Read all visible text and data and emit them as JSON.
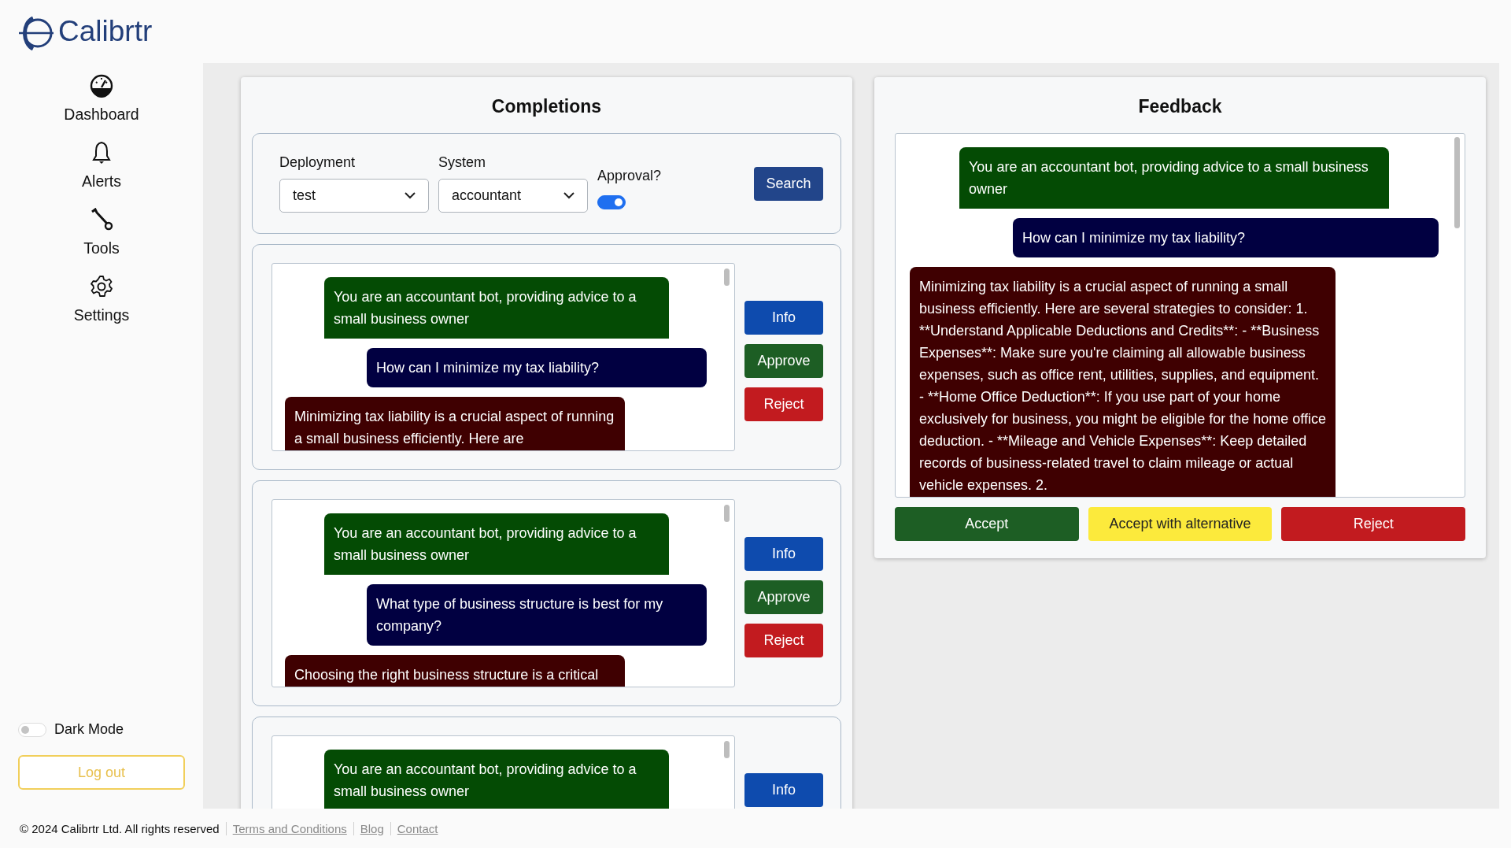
{
  "brand": {
    "name": "Calibrtr"
  },
  "sidebar": {
    "items": [
      {
        "label": "Dashboard",
        "kind": "dashboard"
      },
      {
        "label": "Alerts",
        "kind": "alerts"
      },
      {
        "label": "Tools",
        "kind": "tools"
      },
      {
        "label": "Settings",
        "kind": "settings"
      }
    ],
    "dark_mode": {
      "label": "Dark Mode",
      "on": false
    },
    "logout": "Log out"
  },
  "completions": {
    "title": "Completions",
    "filters": {
      "deployment": {
        "label": "Deployment",
        "value": "test"
      },
      "system": {
        "label": "System",
        "value": "accountant"
      },
      "approval": {
        "label": "Approval?",
        "on": true
      },
      "search": "Search"
    },
    "conversations": [
      {
        "messages": [
          {
            "kind": "system",
            "text": "You are an accountant bot, providing advice to a small business owner"
          },
          {
            "kind": "user",
            "text": "How can I minimize my tax liability?"
          },
          {
            "kind": "assistant",
            "text": "Minimizing tax liability is a crucial aspect of running a small business efficiently. Here are"
          }
        ],
        "buttons": [
          {
            "label": "Info",
            "kind": "info"
          },
          {
            "label": "Approve",
            "kind": "approve"
          },
          {
            "label": "Reject",
            "kind": "reject"
          }
        ]
      },
      {
        "messages": [
          {
            "kind": "system",
            "text": "You are an accountant bot, providing advice to a small business owner"
          },
          {
            "kind": "user",
            "text": "What type of business structure is best for my company?"
          },
          {
            "kind": "assistant",
            "text": "Choosing the right business structure is a critical"
          }
        ],
        "buttons": [
          {
            "label": "Info",
            "kind": "info"
          },
          {
            "label": "Approve",
            "kind": "approve"
          },
          {
            "label": "Reject",
            "kind": "reject"
          }
        ]
      },
      {
        "messages": [
          {
            "kind": "system",
            "text": "You are an accountant bot, providing advice to a small business owner"
          }
        ],
        "buttons": [
          {
            "label": "Info",
            "kind": "info"
          }
        ]
      }
    ]
  },
  "feedback": {
    "title": "Feedback",
    "messages": [
      {
        "kind": "system",
        "text": "You are an accountant bot, providing advice to a small business owner"
      },
      {
        "kind": "user",
        "text": "How can I minimize my tax liability?"
      },
      {
        "kind": "assistant",
        "text": "Minimizing tax liability is a crucial aspect of running a small business efficiently. Here are several strategies to consider: 1. **Understand Applicable Deductions and Credits**: - **Business Expenses**: Make sure you're claiming all allowable business expenses, such as office rent, utilities, supplies, and equipment. - **Home Office Deduction**: If you use part of your home exclusively for business, you might be eligible for the home office deduction. - **Mileage and Vehicle Expenses**: Keep detailed records of business-related travel to claim mileage or actual vehicle expenses. 2."
      }
    ],
    "buttons": [
      {
        "label": "Accept",
        "kind": "accept"
      },
      {
        "label": "Accept with alternative",
        "kind": "alternative"
      },
      {
        "label": "Reject",
        "kind": "reject"
      }
    ]
  },
  "footer": {
    "copyright": "© 2024 Calibrtr Ltd. All rights reserved",
    "links": [
      "Terms and Conditions",
      "Blog",
      "Contact"
    ]
  }
}
